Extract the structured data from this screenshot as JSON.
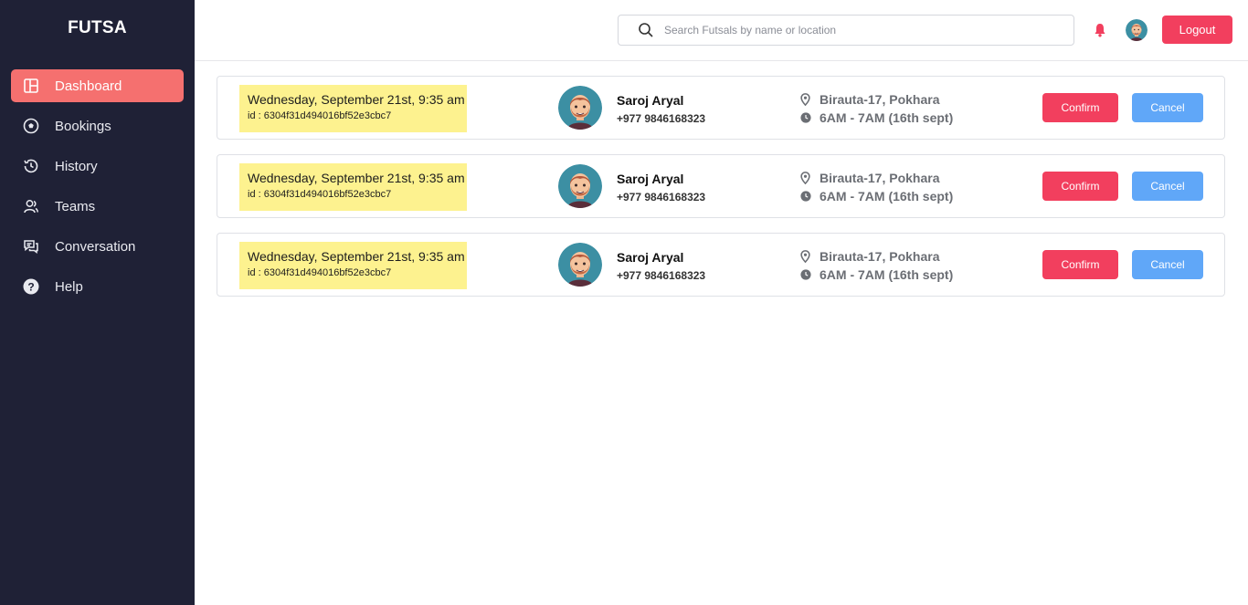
{
  "app": {
    "brand": "FUTSA"
  },
  "sidebar": {
    "items": [
      {
        "label": "Dashboard",
        "icon": "dashboard-icon",
        "active": true
      },
      {
        "label": "Bookings",
        "icon": "football-icon",
        "active": false
      },
      {
        "label": "History",
        "icon": "history-icon",
        "active": false
      },
      {
        "label": "Teams",
        "icon": "teams-icon",
        "active": false
      },
      {
        "label": "Conversation",
        "icon": "chat-icon",
        "active": false
      },
      {
        "label": "Help",
        "icon": "help-icon",
        "active": false
      }
    ]
  },
  "header": {
    "search_placeholder": "Search Futsals by name or location",
    "logout_label": "Logout"
  },
  "bookings": [
    {
      "date": "Wednesday, September 21st, 9:35 am",
      "id": "id : 6304f31d494016bf52e3cbc7",
      "name": "Saroj Aryal",
      "phone": "+977 9846168323",
      "location": "Birauta-17, Pokhara",
      "time": "6AM - 7AM (16th sept)",
      "confirm_label": "Confirm",
      "cancel_label": "Cancel"
    },
    {
      "date": "Wednesday, September 21st, 9:35 am",
      "id": "id : 6304f31d494016bf52e3cbc7",
      "name": "Saroj Aryal",
      "phone": "+977 9846168323",
      "location": "Birauta-17, Pokhara",
      "time": "6AM - 7AM (16th sept)",
      "confirm_label": "Confirm",
      "cancel_label": "Cancel"
    },
    {
      "date": "Wednesday, September 21st, 9:35 am",
      "id": "id : 6304f31d494016bf52e3cbc7",
      "name": "Saroj Aryal",
      "phone": "+977 9846168323",
      "location": "Birauta-17, Pokhara",
      "time": "6AM - 7AM (16th sept)",
      "confirm_label": "Confirm",
      "cancel_label": "Cancel"
    }
  ],
  "colors": {
    "sidebar_bg": "#1f2136",
    "active_item": "#f5706f",
    "confirm": "#f23f5e",
    "cancel": "#60a7f8",
    "date_highlight": "#fdf28f"
  }
}
